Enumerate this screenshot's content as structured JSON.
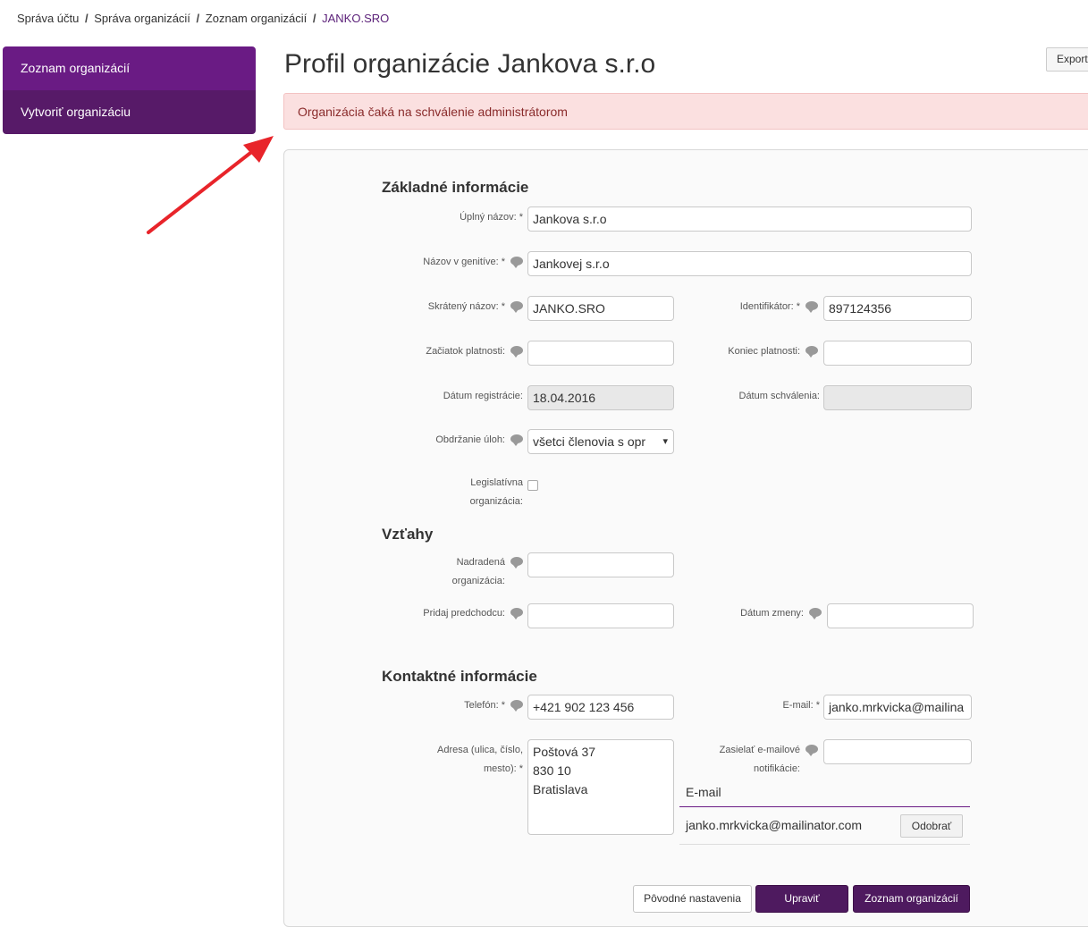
{
  "breadcrumb": {
    "items": [
      "Správa účtu",
      "Správa organizácií",
      "Zoznam organizácií"
    ],
    "current": "JANKO.SRO",
    "separator": "/"
  },
  "sidebar": {
    "items": [
      {
        "label": "Zoznam organizácií"
      },
      {
        "label": "Vytvoriť organizáciu"
      }
    ]
  },
  "export_label": "Export",
  "page_title": "Profil organizácie Jankova s.r.o",
  "alert_text": "Organizácia čaká na schválenie administrátorom",
  "sections": {
    "basic": "Základné informácie",
    "relations": "Vzťahy",
    "contact": "Kontaktné informácie"
  },
  "fields": {
    "full_name": {
      "label": "Úplný názov: *",
      "value": "Jankova s.r.o"
    },
    "genitive": {
      "label": "Názov v genitíve: *",
      "value": "Jankovej s.r.o"
    },
    "short_name": {
      "label": "Skrátený názov: *",
      "value": "JANKO.SRO"
    },
    "identifier": {
      "label": "Identifikátor: *",
      "value": "897124356"
    },
    "valid_from": {
      "label": "Začiatok platnosti:",
      "value": ""
    },
    "valid_to": {
      "label": "Koniec platnosti:",
      "value": ""
    },
    "reg_date": {
      "label": "Dátum registrácie:",
      "value": "18.04.2016"
    },
    "approval_date": {
      "label": "Dátum schválenia:",
      "value": ""
    },
    "tasks": {
      "label": "Obdržanie úloh:",
      "value": "všetci členovia s opr"
    },
    "legislative": {
      "label_line1": "Legislatívna",
      "label_line2": "organizácia:"
    },
    "parent": {
      "label_line1": "Nadradená",
      "label_line2": "organizácia:",
      "value": ""
    },
    "predecessor": {
      "label": "Pridaj predchodcu:",
      "value": ""
    },
    "change_date": {
      "label": "Dátum zmeny:",
      "value": ""
    },
    "phone": {
      "label": "Telefón: *",
      "value": "+421 902 123 456"
    },
    "email": {
      "label": "E-mail: *",
      "value": "janko.mrkvicka@mailina"
    },
    "address": {
      "label_line1": "Adresa (ulica, číslo,",
      "label_line2": "mesto): *",
      "lines": [
        "Poštová 37",
        "830 10",
        "Bratislava"
      ]
    },
    "notify": {
      "label_line1": "Zasielať e-mailové",
      "label_line2": "notifikácie:",
      "value": ""
    }
  },
  "email_table": {
    "header": "E-mail",
    "row_email": "janko.mrkvicka@mailinator.com",
    "remove_label": "Odobrať"
  },
  "buttons": {
    "reset": "Pôvodné nastavenia",
    "edit": "Upraviť",
    "list": "Zoznam organizácií"
  },
  "colors": {
    "primary": "#6a1b84",
    "sidebar_secondary": "#571a68",
    "button_primary": "#4e1a5f",
    "alert_bg": "#fbe0e0",
    "alert_text": "#8a2b2b",
    "arrow": "#e8242a"
  }
}
